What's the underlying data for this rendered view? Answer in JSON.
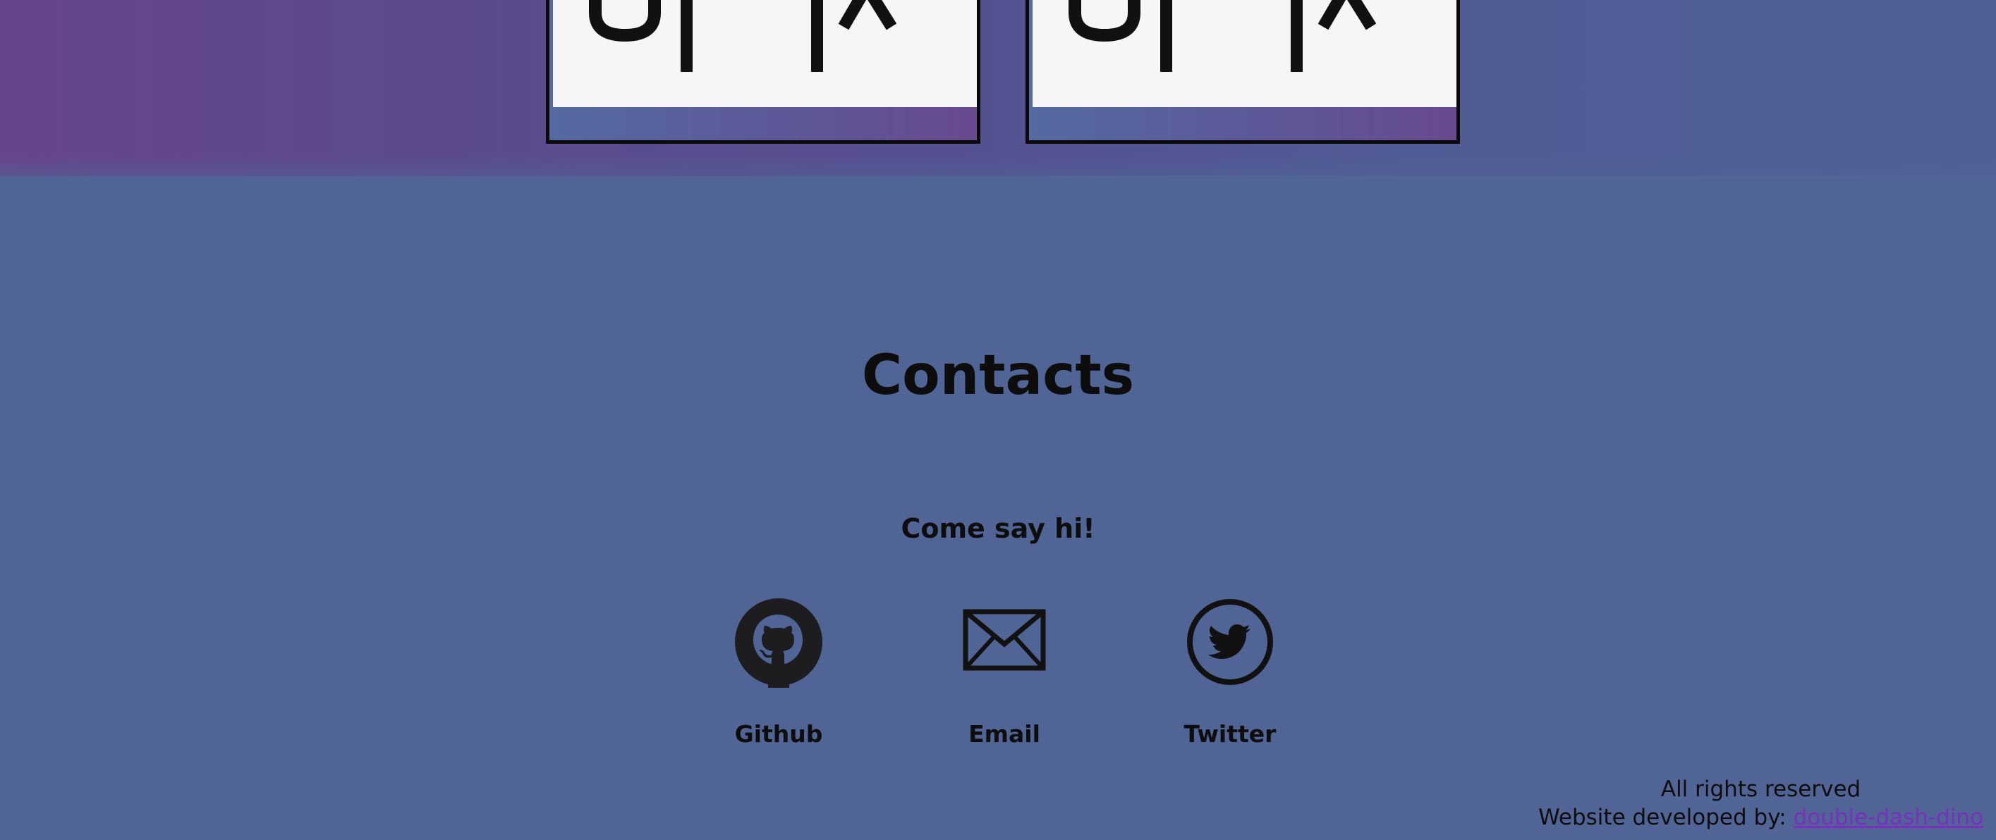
{
  "contacts": {
    "title": "Contacts",
    "subtitle": "Come say hi!",
    "links": {
      "github": {
        "label": "Github",
        "icon": "github-icon"
      },
      "email": {
        "label": "Email",
        "icon": "envelope-icon"
      },
      "twitter": {
        "label": "Twitter",
        "icon": "twitter-icon"
      }
    }
  },
  "footer": {
    "rights": "All rights reserved",
    "developed_by": "Website developed by:",
    "developer_link": "double-dash-dino"
  },
  "colors": {
    "background": "#506496",
    "top_band": "#66468a",
    "link": "#7b2fbf",
    "text": "#0d0d0d"
  }
}
